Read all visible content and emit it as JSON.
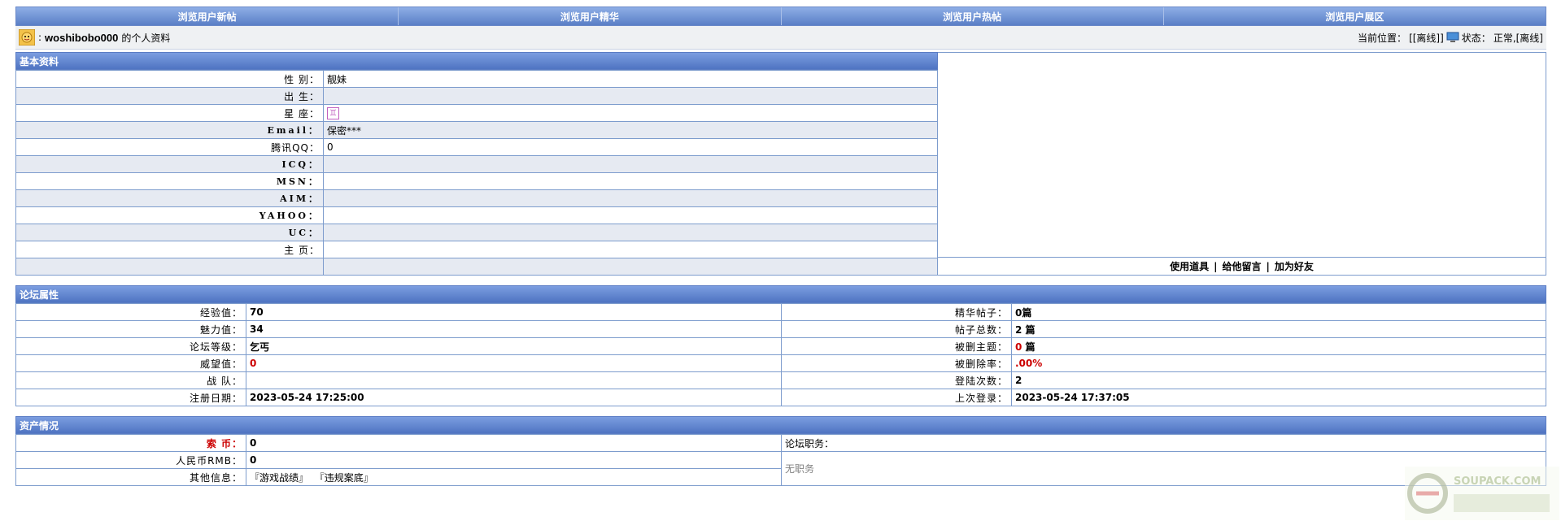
{
  "nav": {
    "tabs": [
      "浏览用户新帖",
      "浏览用户精华",
      "浏览用户热帖",
      "浏览用户展区"
    ]
  },
  "userbar": {
    "username": "woshibobo000",
    "profile_suffix": "的个人资料",
    "location_label": "当前位置：",
    "location_value": "[[离线]]",
    "status_label": "状态：",
    "status_value": "正常,[离线]"
  },
  "basic": {
    "title": "基本资料",
    "rows": [
      {
        "label": "性 别：",
        "value": "靓妹"
      },
      {
        "label": "出 生：",
        "value": ""
      },
      {
        "label": "星 座：",
        "value": "♊"
      },
      {
        "label": "Email：",
        "value": "保密***"
      },
      {
        "label": "腾讯QQ：",
        "value": "0"
      },
      {
        "label": "ICQ：",
        "value": ""
      },
      {
        "label": "MSN：",
        "value": ""
      },
      {
        "label": "AIM：",
        "value": ""
      },
      {
        "label": "YAHOO：",
        "value": ""
      },
      {
        "label": "UC：",
        "value": ""
      },
      {
        "label": "主 页：",
        "value": ""
      }
    ],
    "actions": [
      "使用道具",
      "给他留言",
      "加为好友"
    ]
  },
  "forum": {
    "title": "论坛属性",
    "rows": [
      {
        "l1": "经验值：",
        "v1": "70",
        "l2": "精华帖子：",
        "v2": "0篇"
      },
      {
        "l1": "魅力值：",
        "v1": "34",
        "l2": "帖子总数：",
        "v2": "2 篇"
      },
      {
        "l1": "论坛等级：",
        "v1": "乞丐",
        "l2": "被删主题：",
        "v2a": "0",
        "v2b": " 篇"
      },
      {
        "l1": "威望值：",
        "v1": "0",
        "l2": "被删除率：",
        "v2": ".00%"
      },
      {
        "l1": "战 队：",
        "v1": "",
        "l2": "登陆次数：",
        "v2": "2"
      },
      {
        "l1": "注册日期：",
        "v1": "2023-05-24 17:25:00",
        "l2": "上次登录：",
        "v2": "2023-05-24 17:37:05"
      }
    ]
  },
  "assets": {
    "title": "资产情况",
    "rows": [
      {
        "label": "索 币：",
        "value": "0"
      },
      {
        "label": "人民币RMB：",
        "value": "0"
      },
      {
        "label": "其他信息：",
        "value": ""
      }
    ],
    "links": {
      "open": "『",
      "game": "游戏战绩",
      "close": "』",
      "law": "违规案底"
    },
    "duty_label": "论坛职务：",
    "duty_value": "无职务"
  },
  "watermark": {
    "text": "SOUPACK.COM"
  },
  "colors": {
    "header_blue": "#5a7fc6",
    "row_gray": "#e6eaf2",
    "border": "#7d9ccd",
    "red": "#cc0000"
  }
}
